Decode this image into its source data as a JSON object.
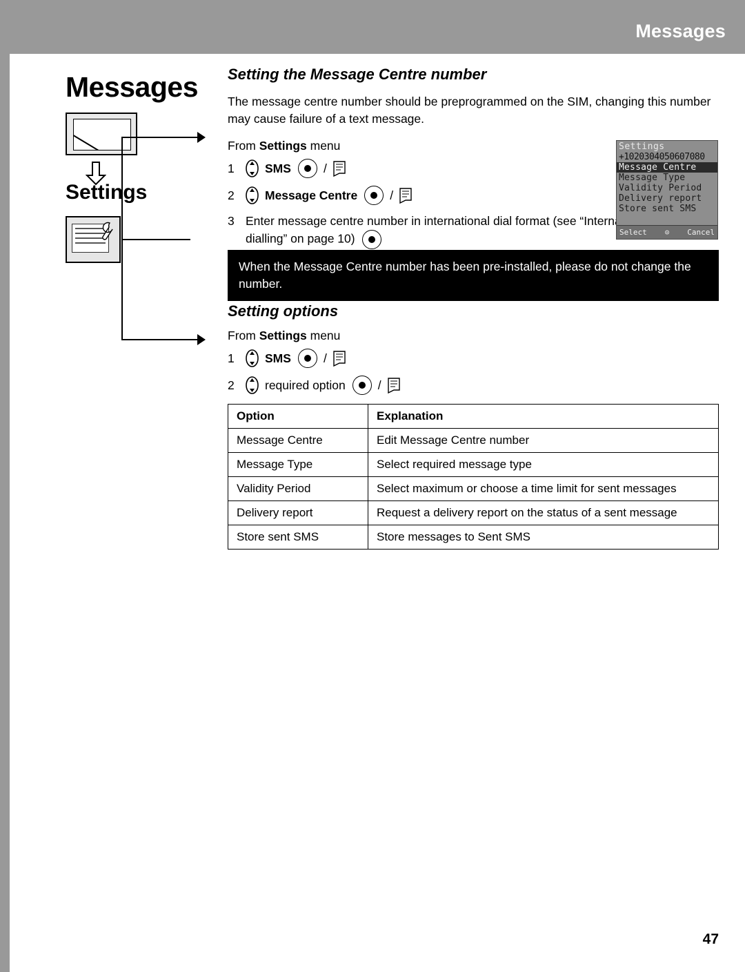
{
  "header": {
    "title": "Messages"
  },
  "sidebar": {
    "chapter": "Messages",
    "sub_label": "Settings",
    "envelope_icon": "envelope-icon",
    "down_arrow_icon": "down-arrow-icon",
    "settings_icon": "settings-card-wrench-icon"
  },
  "section1": {
    "heading": "Setting the Message Centre number",
    "paragraph": "The message centre number should be preprogrammed on the SIM, changing this number may cause failure of a text message.",
    "from_prefix": "From ",
    "from_bold": "Settings",
    "from_suffix": " menu",
    "steps": [
      {
        "num": "1",
        "label": "SMS",
        "bold": true
      },
      {
        "num": "2",
        "label": "Message Centre",
        "bold": true
      },
      {
        "num": "3",
        "label": "Enter message centre number in international dial format (see “International dialling” on page 10)",
        "bold": false
      }
    ]
  },
  "note": "When the Message Centre number has been pre-installed, please do not change the number.",
  "section2": {
    "heading": "Setting options",
    "from_prefix": "From ",
    "from_bold": "Settings",
    "from_suffix": " menu",
    "steps": [
      {
        "num": "1",
        "label": "SMS",
        "bold": true
      },
      {
        "num": "2",
        "label": "required option",
        "bold": false
      }
    ]
  },
  "phone_screen": {
    "title": "Settings",
    "number": "+1020304050607080",
    "items": [
      {
        "text": "Message Centre",
        "selected": true
      },
      {
        "text": "Message Type",
        "selected": false
      },
      {
        "text": "Validity Period",
        "selected": false
      },
      {
        "text": "Delivery report",
        "selected": false
      },
      {
        "text": "Store sent SMS",
        "selected": false
      }
    ],
    "softkey_left": "Select",
    "softkey_center": "⊙",
    "softkey_right": "Cancel"
  },
  "options_table": {
    "headers": [
      "Option",
      "Explanation"
    ],
    "rows": [
      [
        "Message Centre",
        "Edit Message Centre number"
      ],
      [
        "Message Type",
        "Select required message type"
      ],
      [
        "Validity Period",
        "Select maximum or choose a time limit for sent messages"
      ],
      [
        "Delivery report",
        "Request a delivery report on the status of a sent message"
      ],
      [
        "Store sent SMS",
        "Store messages to Sent SMS"
      ]
    ]
  },
  "page_number": "47",
  "colors": {
    "header_gray": "#999999",
    "note_bg": "#000000",
    "note_fg": "#ffffff"
  }
}
